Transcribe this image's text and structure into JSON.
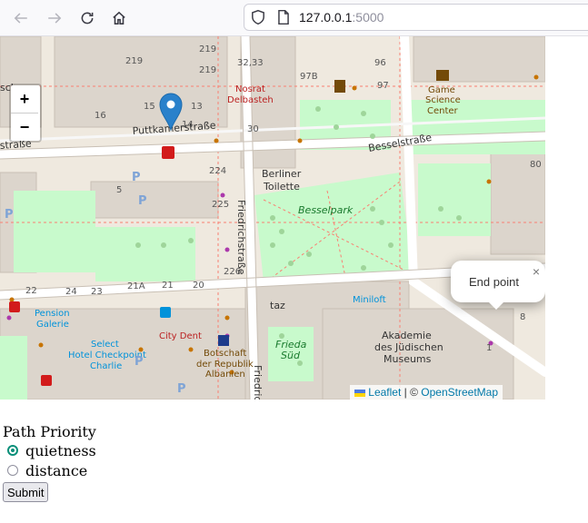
{
  "browser": {
    "url_host": "127.0.0.1",
    "url_port": ":5000",
    "back_icon": "arrow-left-icon",
    "forward_icon": "arrow-right-icon",
    "reload_icon": "reload-icon",
    "home_icon": "home-icon"
  },
  "map": {
    "zoom_in_label": "+",
    "zoom_out_label": "−",
    "attribution_leaflet": "Leaflet",
    "attribution_sep": " | © ",
    "attribution_osm": "OpenStreetMap",
    "popup_text": "End point",
    "popup_close": "×",
    "labels": {
      "puttkamer": "Puttkamerstraße",
      "bessel": "Besselstraße",
      "friedrich1": "Friedrichstraße",
      "friedrich2": "Friedric",
      "besselpark": "Besselpark",
      "berliner": "Berliner",
      "toilette": "Toilette",
      "nosrat1": "Nosrat",
      "nosrat2": "Delbasteh",
      "game1": "Game",
      "game2": "Science",
      "game3": "Center",
      "akad1": "Akademie",
      "akad2": "des Jüdischen",
      "akad3": "Museums",
      "miniloft": "Miniloft",
      "taz": "taz",
      "pension1": "Pension",
      "pension2": "Galerie",
      "select1": "Select",
      "select2": "Hotel Checkpoint",
      "select3": "Charlie",
      "citydent": "City Dent",
      "botsch1": "Botschaft",
      "botsch2": "der Republik",
      "botsch3": "Albanien",
      "frieda1": "Frieda",
      "frieda2": "Süd",
      "strasse": "straße",
      "n219a": "219",
      "n219b": "219",
      "n219c": "219",
      "n3233": "32,33",
      "n97b": "97B",
      "n96": "96",
      "n97": "97",
      "n16": "16",
      "n15": "15",
      "n13": "13",
      "n14": "14",
      "n30": "30",
      "n224": "224",
      "n5": "5",
      "n225": "225",
      "n80": "80",
      "n3": "3",
      "n226": "226",
      "n24": "24",
      "n23": "23",
      "n22": "22",
      "n21a": "21A",
      "n21": "21",
      "n20": "20",
      "n8": "8",
      "n1": "1",
      "nA": "A",
      "sch": "sch"
    }
  },
  "form": {
    "legend": "Path Priority",
    "options": [
      {
        "label": "quietness",
        "checked": true
      },
      {
        "label": "distance",
        "checked": false
      }
    ],
    "submit_label": "Submit"
  }
}
